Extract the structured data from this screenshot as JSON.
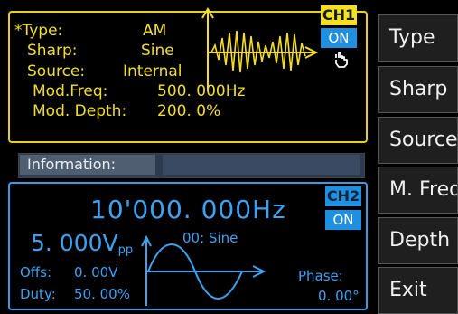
{
  "ch1": {
    "type_label": "*Type:",
    "type_value": "AM",
    "sharp_label": "Sharp:",
    "sharp_value": "Sine",
    "source_label": "Source:",
    "source_value": "Internal",
    "modfreq_label": "Mod.Freq:",
    "modfreq_value": "500. 000Hz",
    "moddepth_label": "Mod. Depth:",
    "moddepth_value": "200. 0%",
    "badge": "CH1",
    "state": "ON",
    "accent_color": "#f2de2a",
    "lock_icon": "hand-pointer-icon"
  },
  "info": {
    "label": "Information:",
    "value": ""
  },
  "ch2": {
    "frequency": "10'000. 000Hz",
    "amplitude": "5. 000V",
    "amplitude_unit": "pp",
    "waveform": "00: Sine",
    "offset_label": "Offs:",
    "offset_value": "0. 00V",
    "duty_label": "Duty:",
    "duty_value": "50. 00%",
    "phase_label": "Phase:",
    "phase_value": "0. 00°",
    "badge": "CH2",
    "state": "ON",
    "accent_color": "#3da2f0"
  },
  "menu": {
    "items": [
      "Type",
      "Sharp",
      "Source",
      "M. Freq",
      "Depth",
      "Exit"
    ]
  }
}
